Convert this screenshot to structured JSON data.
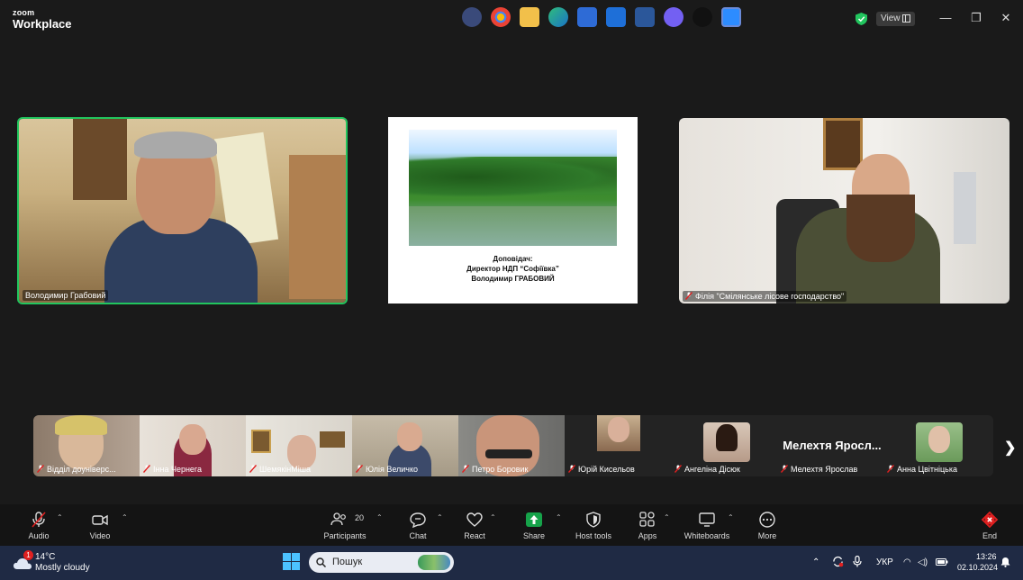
{
  "app": {
    "logo_top": "zoom",
    "logo_bottom": "Workplace",
    "view_label": "View"
  },
  "window_controls": {
    "minimize": "—",
    "restore": "❐",
    "close": "✕"
  },
  "main": {
    "speaker_left": {
      "name": "Володимир Грабовий"
    },
    "slide": {
      "line1": "Доповідач:",
      "line2": "Директор НДП “Софіївка”",
      "line3": "Володимир ГРАБОВИЙ"
    },
    "speaker_right": {
      "name": "Філія \"Смілянське лісове господарство\""
    }
  },
  "thumbnails": [
    {
      "name": "Відділ доуніверс..."
    },
    {
      "name": "Інна Чернега"
    },
    {
      "name": "ШемякінМіша"
    },
    {
      "name": "Юлія Величко"
    },
    {
      "name": "Петро Боровик"
    },
    {
      "name": "Юрій Кисельов"
    },
    {
      "name": "Ангеліна Дісюк"
    },
    {
      "name": "Мелехтя Ярослав",
      "big_label": "Мелехтя Яросл..."
    },
    {
      "name": "Анна Цвітніцька"
    }
  ],
  "toolbar": {
    "audio": "Audio",
    "video": "Video",
    "participants": "Participants",
    "participants_count": "20",
    "chat": "Chat",
    "react": "React",
    "share": "Share",
    "host_tools": "Host tools",
    "apps": "Apps",
    "whiteboards": "Whiteboards",
    "more": "More",
    "end": "End"
  },
  "taskbar": {
    "weather_temp": "14°C",
    "weather_desc": "Mostly cloudy",
    "weather_badge": "1",
    "search_placeholder": "Пошук",
    "language": "УКР",
    "time": "13:26",
    "date": "02.10.2024"
  },
  "colors": {
    "active_speaker_border": "#22c55e",
    "end_red": "#e02020",
    "share_green": "#16a34a",
    "shield_green": "#22c55e"
  }
}
